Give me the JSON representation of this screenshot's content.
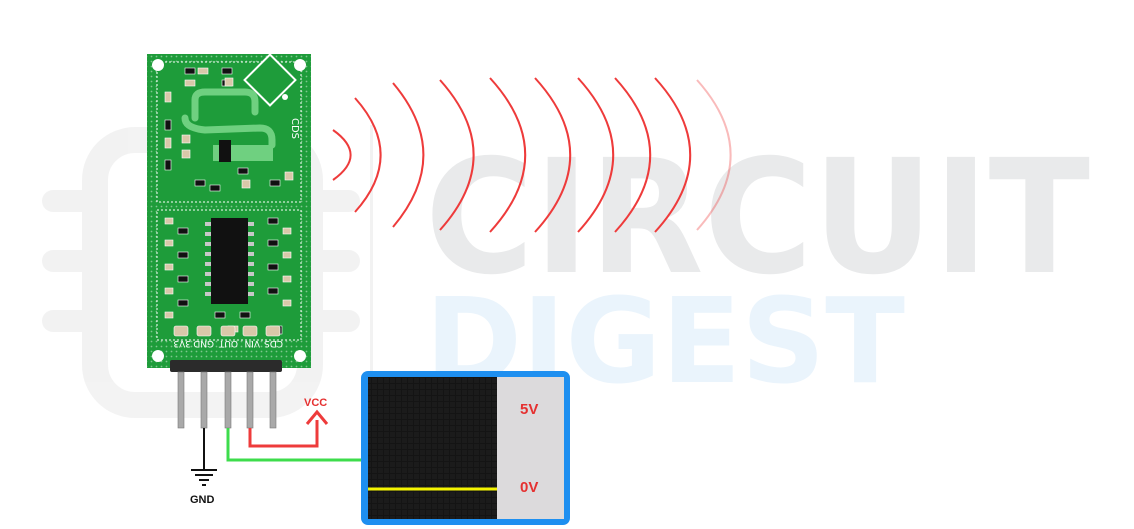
{
  "watermark": {
    "line1": "CIRCUIT",
    "line2": "DIGEST"
  },
  "module": {
    "silkscreen_top": "CDS",
    "pins": [
      "3V3",
      "GND",
      "OUT",
      "VIN",
      "CDS"
    ]
  },
  "labels": {
    "vcc": "VCC",
    "gnd": "GND"
  },
  "scope": {
    "high_label": "5V",
    "low_label": "0V"
  },
  "colors": {
    "pcb": "#1e9c3a",
    "wave": "#ee3b3b",
    "out_wire": "#3ddc4c",
    "vcc_wire": "#ee3b3b",
    "scope_frame": "#1e8ff0",
    "scope_trace": "#f4f400",
    "label_red": "#e53030"
  }
}
